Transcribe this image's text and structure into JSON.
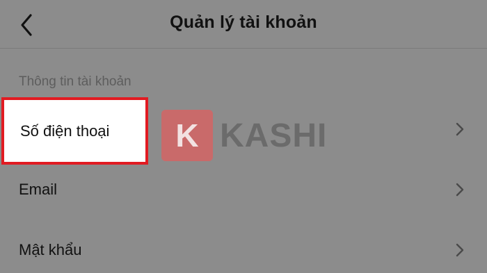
{
  "header": {
    "title": "Quản lý tài khoản",
    "back_icon": "chevron-left-icon"
  },
  "section": {
    "label": "Thông tin tài khoản"
  },
  "rows": [
    {
      "label": "Số điện thoại",
      "icon": "chevron-right-icon",
      "highlighted": true
    },
    {
      "label": "Email",
      "icon": "chevron-right-icon"
    },
    {
      "label": "Mật khẩu",
      "icon": "chevron-right-icon"
    }
  ],
  "watermark": {
    "logo_letter": "K",
    "text": "KASHI"
  },
  "colors": {
    "background": "#8c8c8c",
    "highlight_border": "#e11b22",
    "highlight_fill": "#ffffff",
    "watermark_logo": "#c96a6a"
  }
}
